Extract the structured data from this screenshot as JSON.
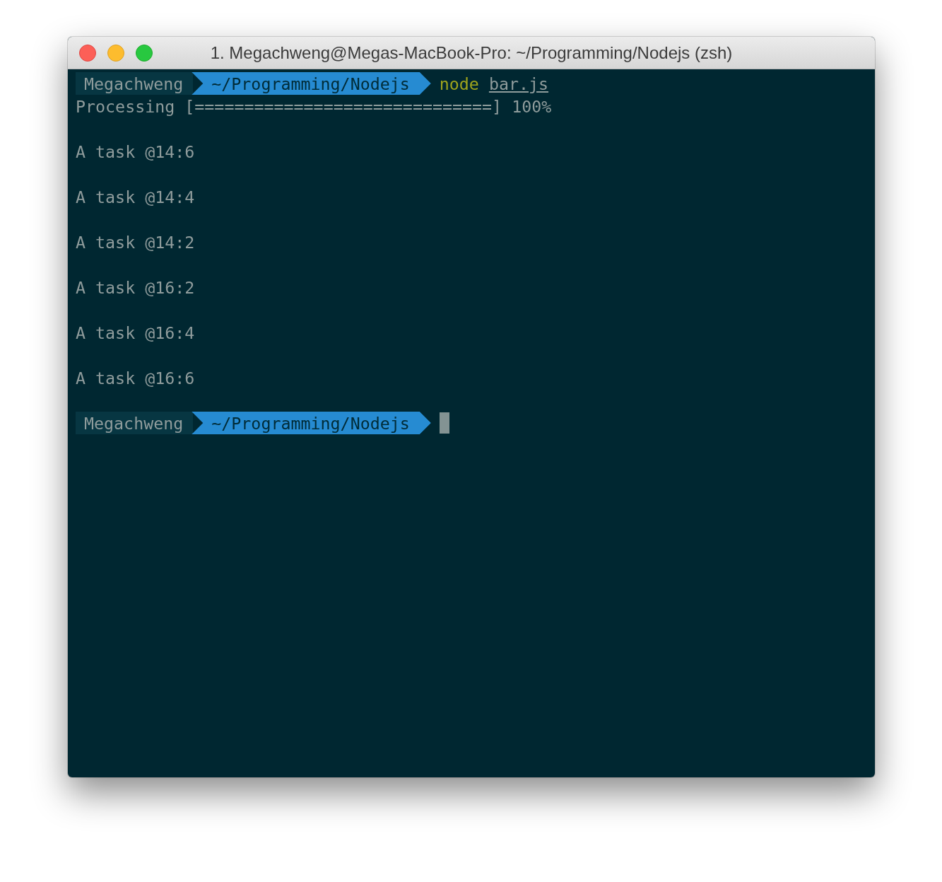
{
  "window": {
    "title": "1. Megachweng@Megas-MacBook-Pro: ~/Programming/Nodejs (zsh)"
  },
  "lines": [
    {
      "kind": "prompt",
      "user": "Megachweng",
      "path": "~/Programming/Nodejs",
      "command": "node",
      "argument": "bar.js",
      "cursor": false
    },
    {
      "kind": "output",
      "text": "Processing [==============================] 100%"
    },
    {
      "kind": "blank"
    },
    {
      "kind": "output",
      "text": "A task @14:6"
    },
    {
      "kind": "blank"
    },
    {
      "kind": "output",
      "text": "A task @14:4"
    },
    {
      "kind": "blank"
    },
    {
      "kind": "output",
      "text": "A task @14:2"
    },
    {
      "kind": "blank"
    },
    {
      "kind": "output",
      "text": "A task @16:2"
    },
    {
      "kind": "blank"
    },
    {
      "kind": "output",
      "text": "A task @16:4"
    },
    {
      "kind": "blank"
    },
    {
      "kind": "output",
      "text": "A task @16:6"
    },
    {
      "kind": "blank"
    },
    {
      "kind": "prompt",
      "user": "Megachweng",
      "path": "~/Programming/Nodejs",
      "cursor": true
    }
  ]
}
